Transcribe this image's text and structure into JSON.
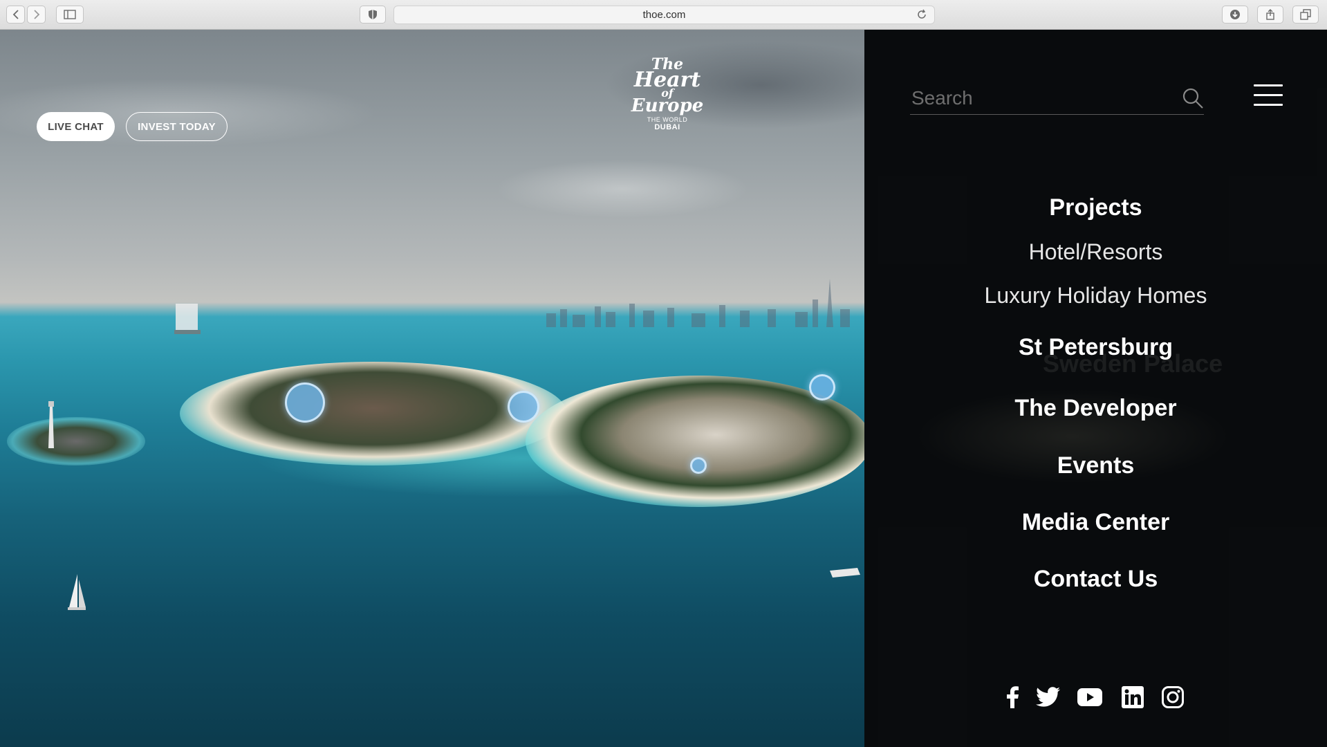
{
  "browser": {
    "url": "thoe.com"
  },
  "hero": {
    "live_chat_label": "LIVE CHAT",
    "invest_label": "INVEST TODAY",
    "logo": {
      "line1": "The",
      "line2": "Heart",
      "line3": "of",
      "line4": "Europe",
      "sub": "THE WORLD",
      "city": "DUBAI"
    }
  },
  "menu": {
    "search_placeholder": "Search",
    "background_label": "Sweden Palace",
    "items": [
      {
        "label": "Projects",
        "style": "bold"
      },
      {
        "label": "Hotel/Resorts",
        "style": "light"
      },
      {
        "label": "Luxury Holiday Homes",
        "style": "light"
      },
      {
        "label": "St Petersburg",
        "style": "bold"
      },
      {
        "label": "The Developer",
        "style": "bold"
      },
      {
        "label": "Events",
        "style": "bold"
      },
      {
        "label": "Media Center",
        "style": "bold"
      },
      {
        "label": "Contact Us",
        "style": "bold"
      }
    ],
    "social": [
      "facebook-icon",
      "twitter-icon",
      "youtube-icon",
      "linkedin-icon",
      "instagram-icon"
    ]
  },
  "colors": {
    "panel_bg": "#0a0c0e",
    "accent_hotspot": "#6eb4e6",
    "text": "#ffffff"
  }
}
